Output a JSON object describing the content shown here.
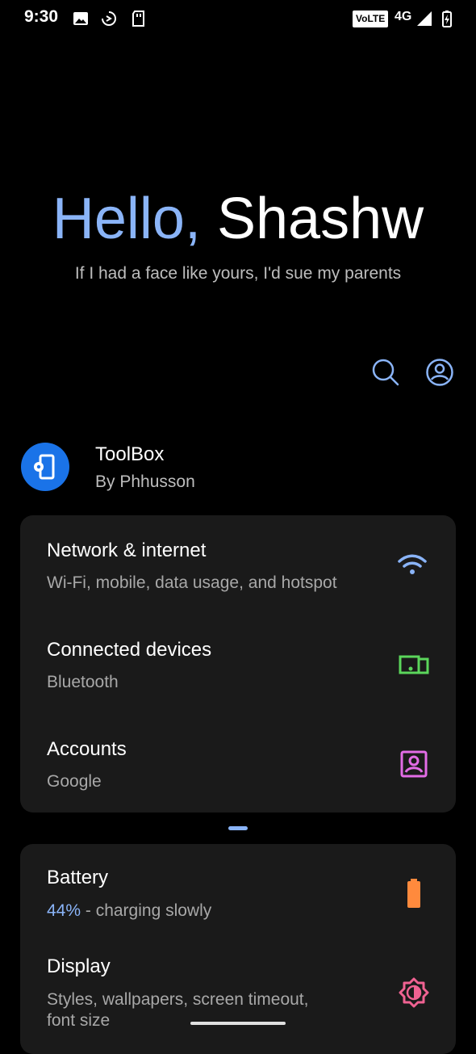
{
  "status_bar": {
    "time": "9:30",
    "volte": "VoLTE",
    "network": "4G",
    "icons": [
      "image-icon",
      "sync-icon",
      "sd-card-icon",
      "signal-icon",
      "battery-charging-icon"
    ]
  },
  "hero": {
    "greeting": "Hello,",
    "name": "Shashw",
    "subtitle": "If I had a face like yours, I'd sue my parents"
  },
  "actions": {
    "search_icon": "search-icon",
    "account_icon": "account-circle-icon"
  },
  "suggestion": {
    "title": "ToolBox",
    "subtitle": "By Phhusson"
  },
  "group1": [
    {
      "title": "Network & internet",
      "subtitle": "Wi-Fi, mobile, data usage, and hotspot",
      "icon": "wifi-icon",
      "color": "#8ab4f8"
    },
    {
      "title": "Connected devices",
      "subtitle": "Bluetooth",
      "icon": "devices-icon",
      "color": "#5bd65b"
    },
    {
      "title": "Accounts",
      "subtitle": "Google",
      "icon": "account-box-icon",
      "color": "#e36ce6"
    }
  ],
  "group2": [
    {
      "title": "Battery",
      "subtitle_accent": "44%",
      "subtitle": " - charging slowly",
      "icon": "battery-icon",
      "color": "#ff8a3d"
    },
    {
      "title": "Display",
      "subtitle": "Styles, wallpapers, screen timeout,",
      "subtitle2": "font size",
      "icon": "brightness-icon",
      "color": "#f06292"
    }
  ],
  "colors": {
    "accent": "#8ab4f8",
    "background": "#000000",
    "card": "#1a1a1a"
  }
}
